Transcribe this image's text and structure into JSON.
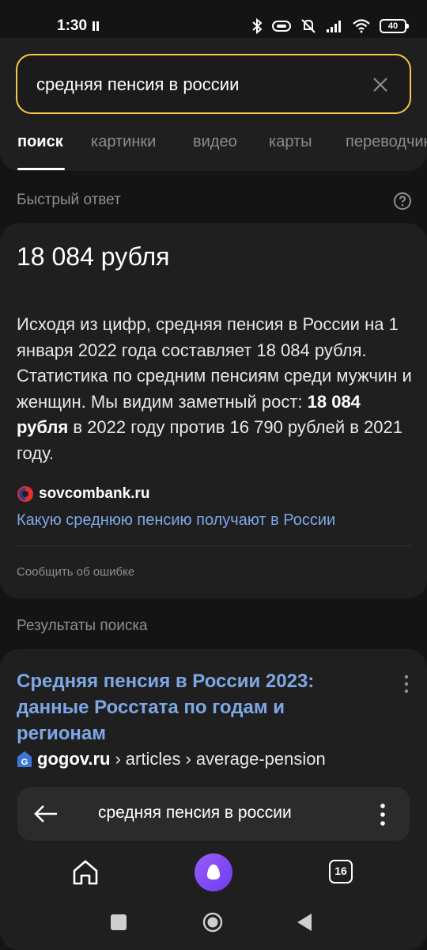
{
  "status_bar": {
    "time": "1:30",
    "battery": "40",
    "icons": [
      "sim-icon",
      "bluetooth-icon",
      "data-saver-icon",
      "mute-icon",
      "signal-icon",
      "wifi-icon",
      "battery-icon"
    ]
  },
  "search": {
    "query": "средняя пенсия в россии",
    "accent": "#f5c94a"
  },
  "tabs": [
    {
      "label": "поиск",
      "active": true
    },
    {
      "label": "картинки"
    },
    {
      "label": "видео"
    },
    {
      "label": "карты"
    },
    {
      "label": "переводчик"
    }
  ],
  "quick_answer": {
    "section_label": "Быстрый ответ",
    "title": "18 084 рубля",
    "text_before": "Исходя из цифр, средняя пенсия в России на 1 января 2022 года составляет 18 084 рубля. Статистика по средним пенсиям среди мужчин и женщин. Мы видим заметный рост: ",
    "text_bold": "18 084 рубля",
    "text_after": " в 2022 году против 16 790 рублей в 2021 году.",
    "source": "sovcombank.ru",
    "link": "Какую среднюю пенсию получают в России",
    "report": "Сообщить об ошибке"
  },
  "results": {
    "section_label": "Результаты поиска",
    "items": [
      {
        "title": "Средняя пенсия в России 2023: данные Росстата по годам и регионам",
        "domain": "gogov.ru",
        "path1": "articles",
        "path2": "average-pension",
        "separator": "›"
      }
    ]
  },
  "bottom_bar": {
    "query": "средняя пенсия в россии"
  },
  "nav": {
    "tabs_count": "16"
  },
  "colors": {
    "background": "#141414",
    "card": "#1f1f1f",
    "link": "#7ea7e6",
    "muted": "#8f8f8f"
  }
}
